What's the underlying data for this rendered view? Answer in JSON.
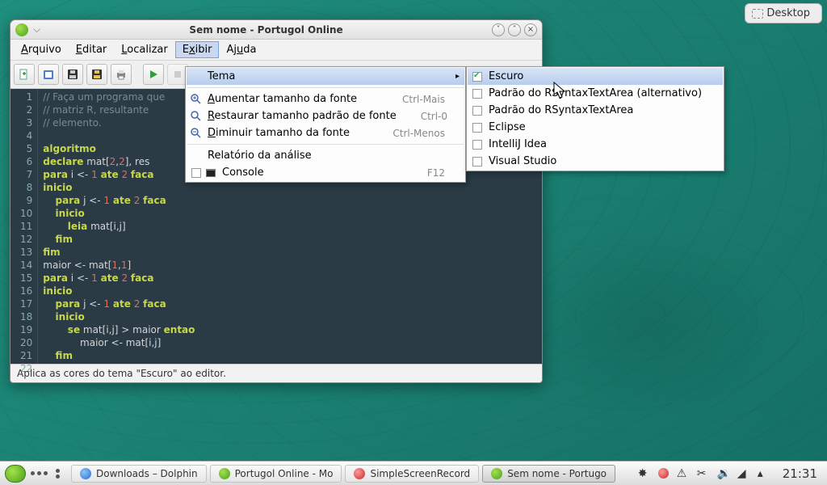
{
  "desktop_button": "Desktop",
  "window": {
    "title": "Sem nome - Portugol Online",
    "menubar": [
      "Arquivo",
      "Editar",
      "Localizar",
      "Exibir",
      "Ajuda"
    ],
    "open_menu_index": 3,
    "status": "Aplica as cores do tema \"Escuro\" ao editor."
  },
  "exibir_menu": {
    "tema": "Tema",
    "zoom_in": "Aumentar tamanho da fonte",
    "zoom_in_key": "Ctrl-Mais",
    "zoom_reset": "Restaurar tamanho padrão de fonte",
    "zoom_reset_key": "Ctrl-0",
    "zoom_out": "Diminuir tamanho da fonte",
    "zoom_out_key": "Ctrl-Menos",
    "relatorio": "Relatório da análise",
    "console": "Console",
    "console_key": "F12"
  },
  "tema_submenu": [
    "Escuro",
    "Padrão do RSyntaxTextArea (alternativo)",
    "Padrão do RSyntaxTextArea",
    "Eclipse",
    "IntelliJ Idea",
    "Visual Studio"
  ],
  "tema_selected_index": 0,
  "code_lines": [
    "// Faça um programa que",
    "// matriz R, resultante",
    "// elemento.",
    "",
    "algoritmo",
    "declare mat[2,2], res",
    "para i <- 1 ate 2 faca",
    "inicio",
    "    para j <- 1 ate 2 faca",
    "    inicio",
    "        leia mat[i,j]",
    "    fim",
    "fim",
    "maior <- mat[1,1]",
    "para i <- 1 ate 2 faca",
    "inicio",
    "    para j <- 1 ate 2 faca",
    "    inicio",
    "        se mat[i,j] > maior entao",
    "            maior <- mat[i,j]",
    "    fim",
    "fim"
  ],
  "taskbar": {
    "items": [
      {
        "label": "Downloads – Dolphin",
        "icon": "blue"
      },
      {
        "label": "Portugol Online - Mo",
        "icon": "green"
      },
      {
        "label": "SimpleScreenRecord",
        "icon": "red"
      },
      {
        "label": "Sem nome - Portugo",
        "icon": "green",
        "active": true
      }
    ],
    "clock": "21:31"
  }
}
